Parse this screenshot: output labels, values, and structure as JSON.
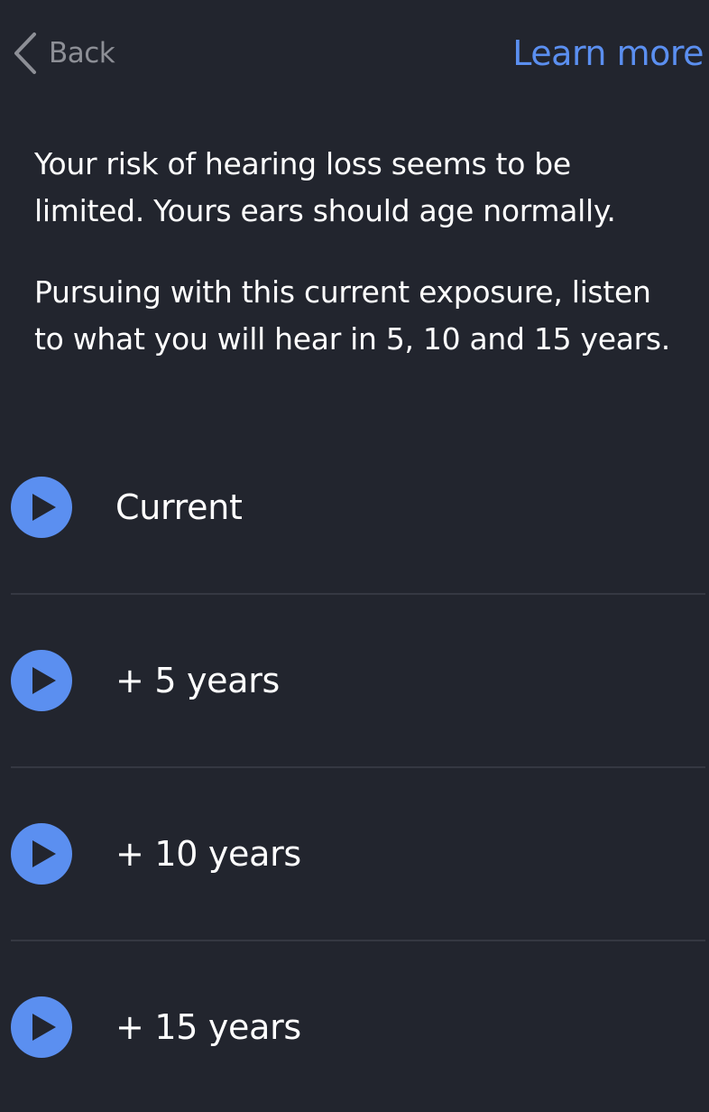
{
  "nav": {
    "back_label": "Back",
    "learn_more_label": "Learn more"
  },
  "message": {
    "paragraph1": "Your risk of hearing loss seems to be limited. Yours ears should age normally.",
    "paragraph2": "Pursuing with this current exposure, listen to what you will hear in 5, 10 and 15 years."
  },
  "samples": [
    {
      "label": "Current",
      "icon": "play-icon"
    },
    {
      "label": "+ 5 years",
      "icon": "play-icon"
    },
    {
      "label": "+ 10 years",
      "icon": "play-icon"
    },
    {
      "label": "+ 15 years",
      "icon": "play-icon"
    }
  ],
  "colors": {
    "background": "#22252e",
    "accent": "#5b8ff0",
    "text": "#ffffff",
    "muted": "#8d8f96",
    "divider": "#353842"
  }
}
